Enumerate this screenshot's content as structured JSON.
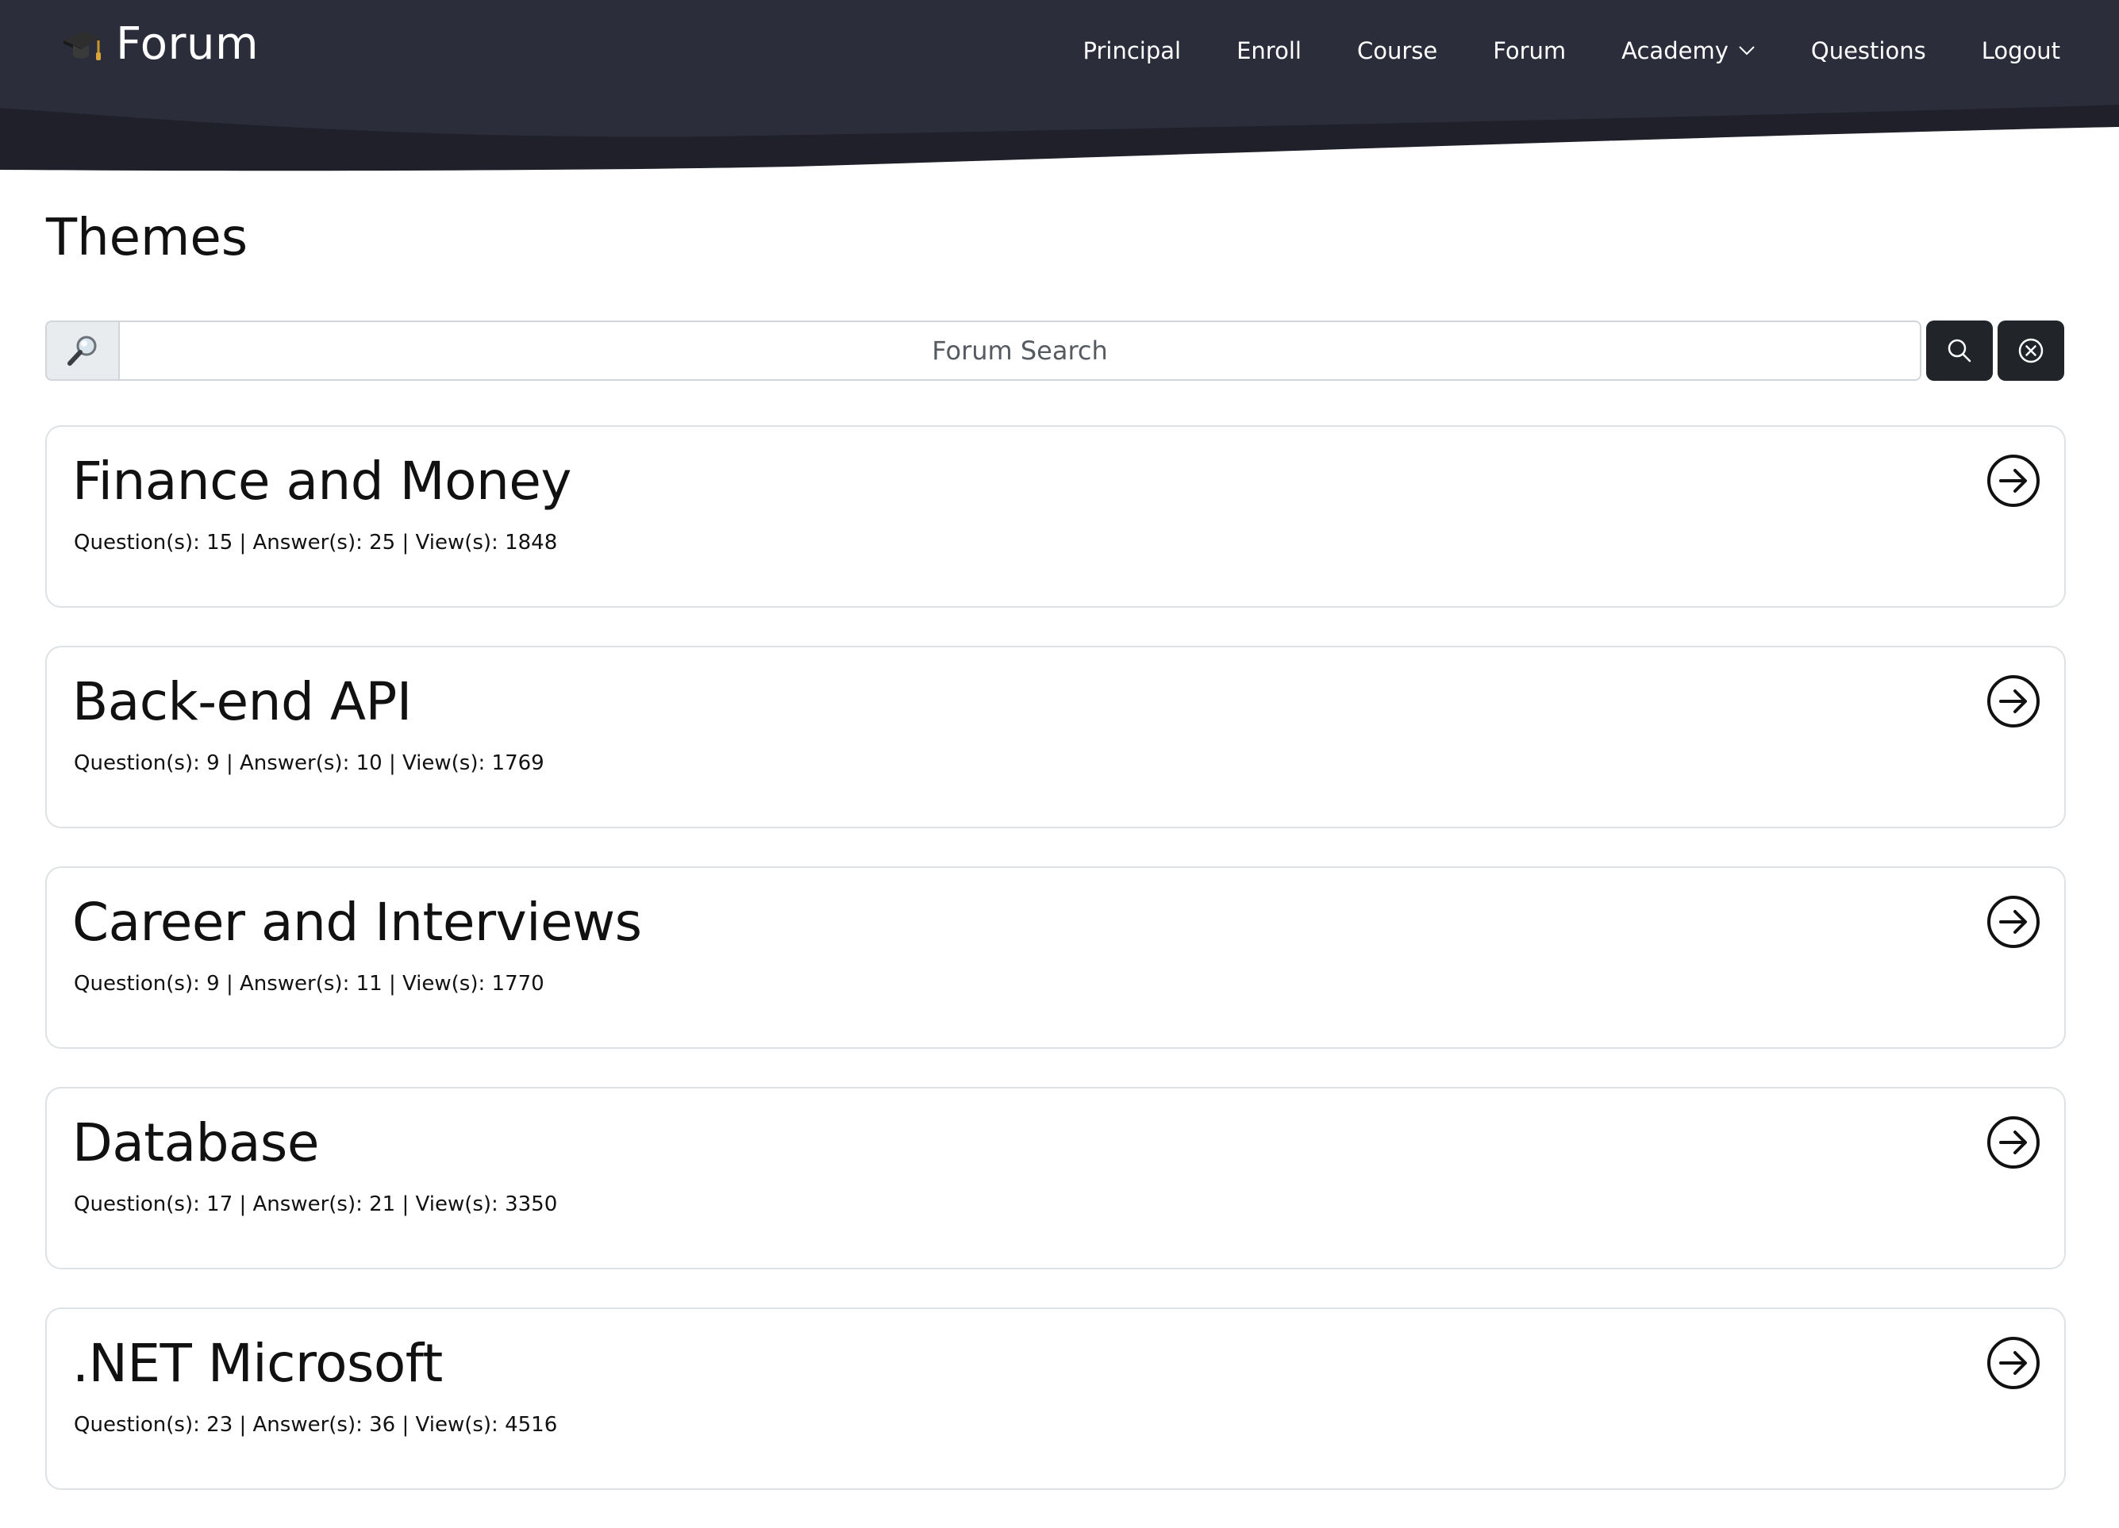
{
  "header": {
    "brand_title": "Forum",
    "nav": [
      {
        "label": "Principal",
        "icon": null
      },
      {
        "label": "Enroll",
        "icon": null
      },
      {
        "label": "Course",
        "icon": null
      },
      {
        "label": "Forum",
        "icon": null
      },
      {
        "label": "Academy",
        "icon": "chevron-down-icon"
      },
      {
        "label": "Questions",
        "icon": null
      },
      {
        "label": "Logout",
        "icon": null
      }
    ],
    "colors": {
      "background": "#2b2d3b",
      "wave": "#1f2029"
    }
  },
  "page": {
    "title": "Themes"
  },
  "search": {
    "placeholder": "Forum Search",
    "value": "",
    "prefix_icon": "magnifier-icon",
    "search_button_icon": "search-icon",
    "clear_button_icon": "clear-circle-icon"
  },
  "topics": [
    {
      "title": "Finance and Money",
      "stats": "Question(s): 15 | Answer(s): 25 | View(s): 1848"
    },
    {
      "title": "Back-end API",
      "stats": "Question(s): 9 | Answer(s): 10 | View(s): 1769"
    },
    {
      "title": "Career and Interviews",
      "stats": "Question(s): 9 | Answer(s): 11 | View(s): 1770"
    },
    {
      "title": "Database",
      "stats": "Question(s): 17 | Answer(s): 21 | View(s): 3350"
    },
    {
      "title": ".NET Microsoft",
      "stats": "Question(s): 23 | Answer(s): 36 | View(s): 4516"
    }
  ],
  "topic_action_icon": "arrow-right-circle-icon"
}
